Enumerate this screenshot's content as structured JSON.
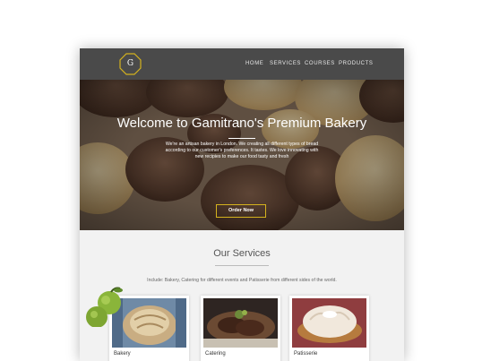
{
  "brand": {
    "logo_text": "G",
    "accent": "#d4b21e"
  },
  "nav": {
    "items": [
      {
        "label": "HOME"
      },
      {
        "label": "SERVICES"
      },
      {
        "label": "COURSES"
      },
      {
        "label": "PRODUCTS"
      }
    ],
    "background": "#4a4a4a"
  },
  "hero": {
    "title": "Welcome to Gamitrano's Premium Bakery",
    "text": "We're an artisan bakery in London. We creating all different types of bread according to our customer's preferences. It tastes. We love innovating with new recipies to make our food tasty and fresh",
    "button_label": "Order Now"
  },
  "services": {
    "title": "Our Services",
    "subtitle": "Include: Bakery, Catering for different events and Patisserie from different sides of the world.",
    "cards": [
      {
        "label": "Bakery"
      },
      {
        "label": "Catering"
      },
      {
        "label": "Patisserie"
      }
    ]
  }
}
